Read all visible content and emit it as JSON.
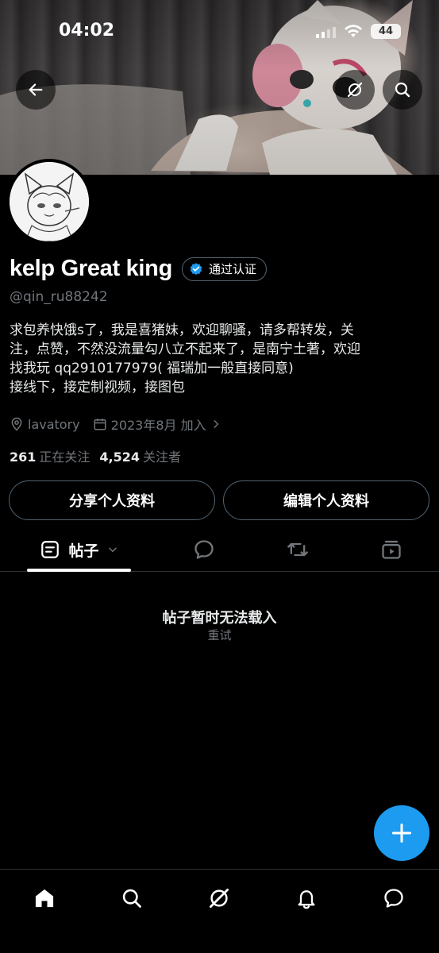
{
  "status_bar": {
    "time": "04:02",
    "battery": "44"
  },
  "profile": {
    "display_name": "kelp Great king",
    "verified_label": "通过认证",
    "handle": "@qin_ru88242",
    "bio_lines": [
      "求包养快饿s了，我是喜猪妹，欢迎聊骚，请多帮转发，关",
      "注，点赞，不然没流量勾八立不起来了，是南宁土著，欢迎",
      "找我玩 qq2910177979( 福瑞加一般直接同意)",
      "接线下，接定制视频，接图包"
    ],
    "location": "lavatory",
    "joined": "2023年8月 加入",
    "following_count": "261",
    "following_label": "正在关注",
    "followers_count": "4,524",
    "followers_label": "关注者"
  },
  "buttons": {
    "share": "分享个人资料",
    "edit": "编辑个人资料"
  },
  "tabs": {
    "posts_label": "帖子",
    "icons": [
      "posts-icon",
      "replies-icon",
      "reposts-icon",
      "media-icon"
    ]
  },
  "empty_state": {
    "title": "帖子暂时无法载入",
    "retry": "重试"
  },
  "colors": {
    "accent": "#1d9bf0",
    "background": "#000000",
    "muted": "#71767b",
    "border": "#536471"
  }
}
